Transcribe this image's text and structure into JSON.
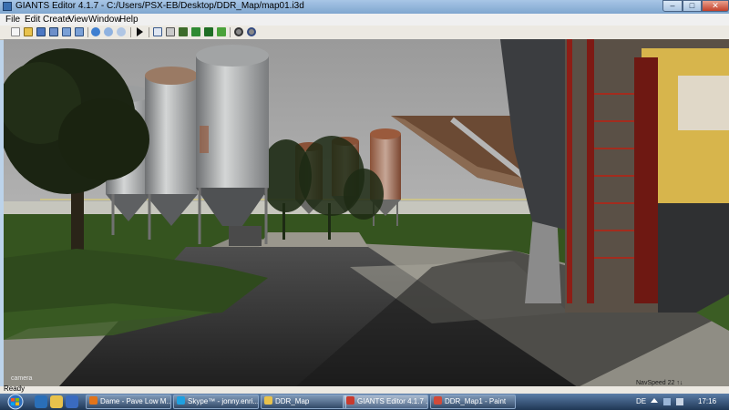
{
  "window": {
    "title": "GIANTS Editor 4.1.7 - C:/Users/PSX-EB/Desktop/DDR_Map/map01.i3d",
    "minimize": "–",
    "maximize": "□",
    "close": "✕"
  },
  "menu": [
    "File",
    "Edit",
    "Create",
    "View",
    "Window",
    "Help"
  ],
  "toolbar_icons": [
    "new-icon",
    "open-icon",
    "save-icon",
    "save-as-icon",
    "import-icon",
    "export-icon",
    "undo-icon",
    "redo-icon",
    "play-icon",
    "select-icon",
    "move-icon",
    "terrain-icon",
    "paint-icon",
    "foliage-icon",
    "grass-icon",
    "settings-icon",
    "tools-icon"
  ],
  "viewport": {
    "camera_label": "camera",
    "nav_speed": "NavSpeed 22 ↑↓"
  },
  "status": {
    "left": "Ready"
  },
  "taskbar": {
    "tasks": [
      {
        "label": "Dame - Pave Low M...",
        "color": "#e2741a"
      },
      {
        "label": "Skype™ - jonny.enri...",
        "color": "#1ea0e0"
      },
      {
        "label": "DDR_Map",
        "color": "#e8c24c"
      },
      {
        "label": "GIANTS Editor 4.1.7 ...",
        "color": "#c83a2e"
      },
      {
        "label": "DDR_Map1 - Paint",
        "color": "#d04a3a"
      }
    ],
    "language": "DE",
    "clock": "17:16"
  },
  "colors": {
    "sky": "#a2a2a2",
    "grass": "#35541f",
    "road": "#2b2b2b"
  }
}
